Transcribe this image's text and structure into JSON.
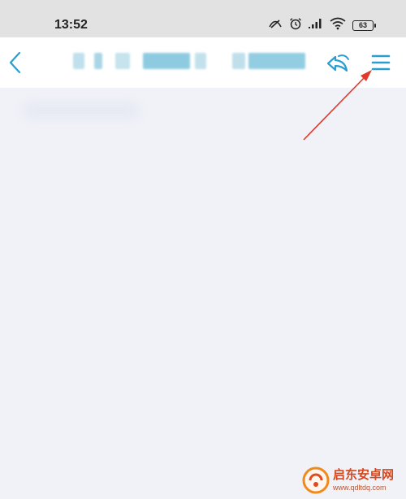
{
  "status_bar": {
    "time": "13:52",
    "battery": "63",
    "icons": [
      "data-saver-icon",
      "alarm-icon",
      "signal-icon",
      "wifi-icon",
      "battery-icon"
    ]
  },
  "nav": {
    "back_icon": "chevron-left-icon",
    "title": "",
    "share_icon": "share-arrow-icon",
    "menu_icon": "hamburger-menu-icon"
  },
  "colors": {
    "accent": "#2a9fcf",
    "status_bg": "#e2e2e2",
    "nav_bg": "#ffffff",
    "content_bg": "#f1f2f8",
    "annotation": "#e03a2c"
  },
  "watermark": {
    "text": "启东安卓网",
    "url": "www.qdltdq.com"
  }
}
